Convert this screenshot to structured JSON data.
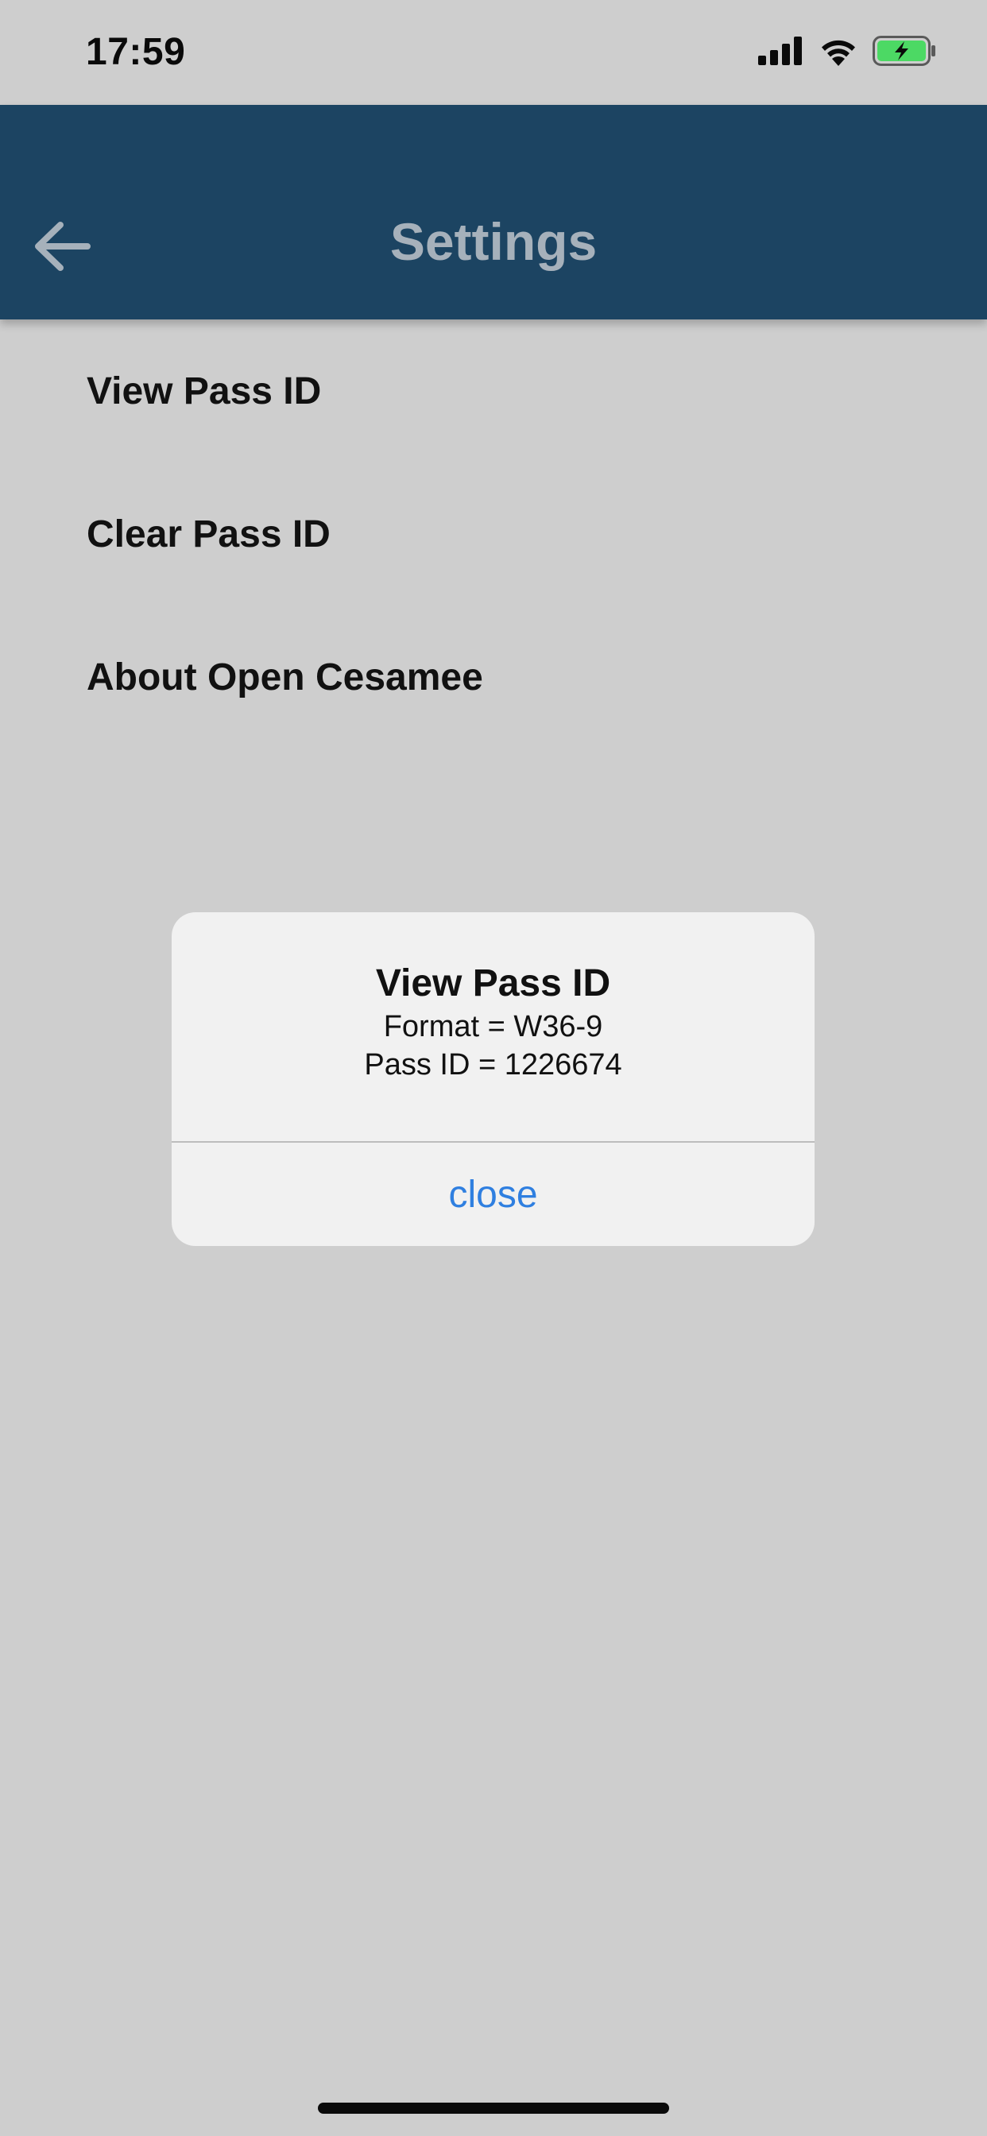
{
  "status_bar": {
    "time": "17:59",
    "icons": [
      "cellular-signal-icon",
      "wifi-icon",
      "battery-charging-icon"
    ]
  },
  "app_bar": {
    "title": "Settings",
    "back_icon": "arrow-left-icon",
    "background_color": "#1c4462",
    "title_color": "#a6b1bb"
  },
  "menu": {
    "items": [
      {
        "label": "View Pass ID"
      },
      {
        "label": "Clear Pass ID"
      },
      {
        "label": "About Open Cesamee"
      }
    ]
  },
  "dialog": {
    "title": "View Pass ID",
    "format_line": "Format = W36-9",
    "pass_id_line": "Pass ID = 1226674",
    "close_label": "close",
    "accent_color": "#2f7fe0"
  },
  "colors": {
    "background": "#cecece",
    "battery_fill": "#4cd964"
  }
}
